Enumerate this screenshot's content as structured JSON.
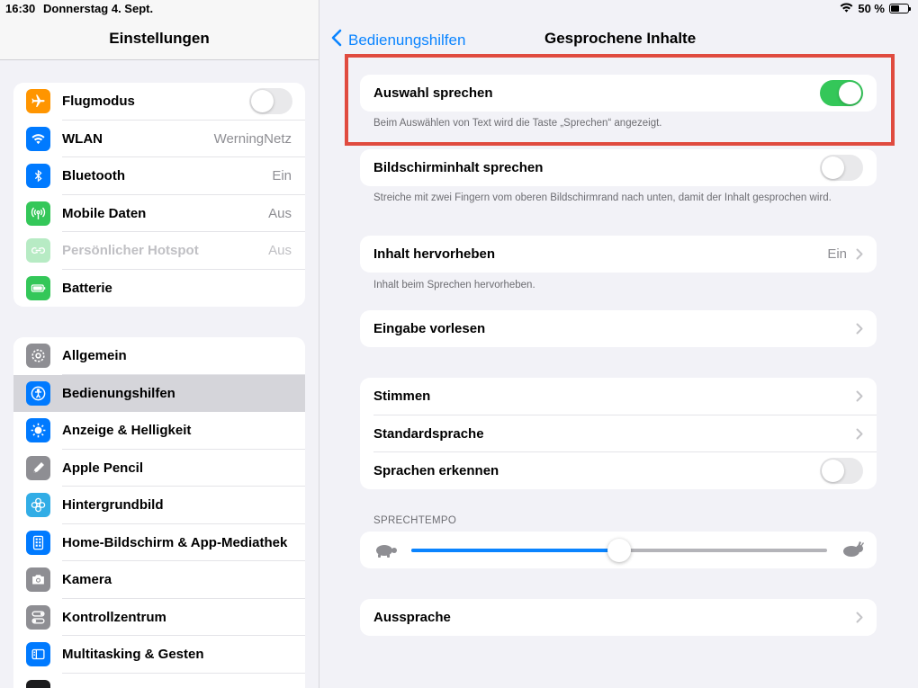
{
  "status": {
    "time": "16:30",
    "date": "Donnerstag 4. Sept.",
    "battery_text": "50 %",
    "battery_level": 0.5
  },
  "sidebar": {
    "title": "Einstellungen",
    "group1": [
      {
        "label": "Flugmodus",
        "icon": "airplane-icon",
        "color": "#ff9500",
        "toggle": false
      },
      {
        "label": "WLAN",
        "icon": "wifi-icon",
        "color": "#007aff",
        "value": "WerningNetz"
      },
      {
        "label": "Bluetooth",
        "icon": "bluetooth-icon",
        "color": "#007aff",
        "value": "Ein"
      },
      {
        "label": "Mobile Daten",
        "icon": "antenna-icon",
        "color": "#34c759",
        "value": "Aus"
      },
      {
        "label": "Persönlicher Hotspot",
        "icon": "hotspot-icon",
        "color": "#34c759",
        "value": "Aus",
        "disabled": true
      },
      {
        "label": "Batterie",
        "icon": "battery-icon",
        "color": "#34c759"
      }
    ],
    "group2": [
      {
        "label": "Allgemein",
        "icon": "gear-icon",
        "color": "#8e8e93"
      },
      {
        "label": "Bedienungshilfen",
        "icon": "accessibility-icon",
        "color": "#007aff",
        "selected": true
      },
      {
        "label": "Anzeige & Helligkeit",
        "icon": "sun-icon",
        "color": "#007aff"
      },
      {
        "label": "Apple Pencil",
        "icon": "pencil-icon",
        "color": "#8e8e93"
      },
      {
        "label": "Hintergrundbild",
        "icon": "flower-icon",
        "color": "#32ade6"
      },
      {
        "label": "Home-Bildschirm & App-Mediathek",
        "icon": "home-screen-icon",
        "color": "#007aff"
      },
      {
        "label": "Kamera",
        "icon": "camera-icon",
        "color": "#8e8e93"
      },
      {
        "label": "Kontrollzentrum",
        "icon": "switches-icon",
        "color": "#8e8e93"
      },
      {
        "label": "Multitasking & Gesten",
        "icon": "multitasking-icon",
        "color": "#007aff"
      }
    ]
  },
  "main": {
    "back_label": "Bedienungshilfen",
    "title": "Gesprochene Inhalte",
    "auswahl": {
      "label": "Auswahl sprechen",
      "toggle": true,
      "footnote": "Beim Auswählen von Text wird die Taste „Sprechen“ angezeigt."
    },
    "bildschirm": {
      "label": "Bildschirminhalt sprechen",
      "toggle": false,
      "footnote": "Streiche mit zwei Fingern vom oberen Bildschirmrand nach unten, damit der Inhalt gesprochen wird."
    },
    "hervorheben": {
      "label": "Inhalt hervorheben",
      "value": "Ein",
      "footnote": "Inhalt beim Sprechen hervorheben."
    },
    "eingabe": {
      "label": "Eingabe vorlesen"
    },
    "voices": {
      "stimmen": "Stimmen",
      "standardsprache": "Standardsprache",
      "sprachen_erkennen": "Sprachen erkennen",
      "sprachen_erkennen_toggle": false
    },
    "sprechtempo": {
      "header": "SPRECHTEMPO",
      "value": 0.5
    },
    "aussprache": {
      "label": "Aussprache"
    },
    "highlight_color": "#e04b3f"
  }
}
